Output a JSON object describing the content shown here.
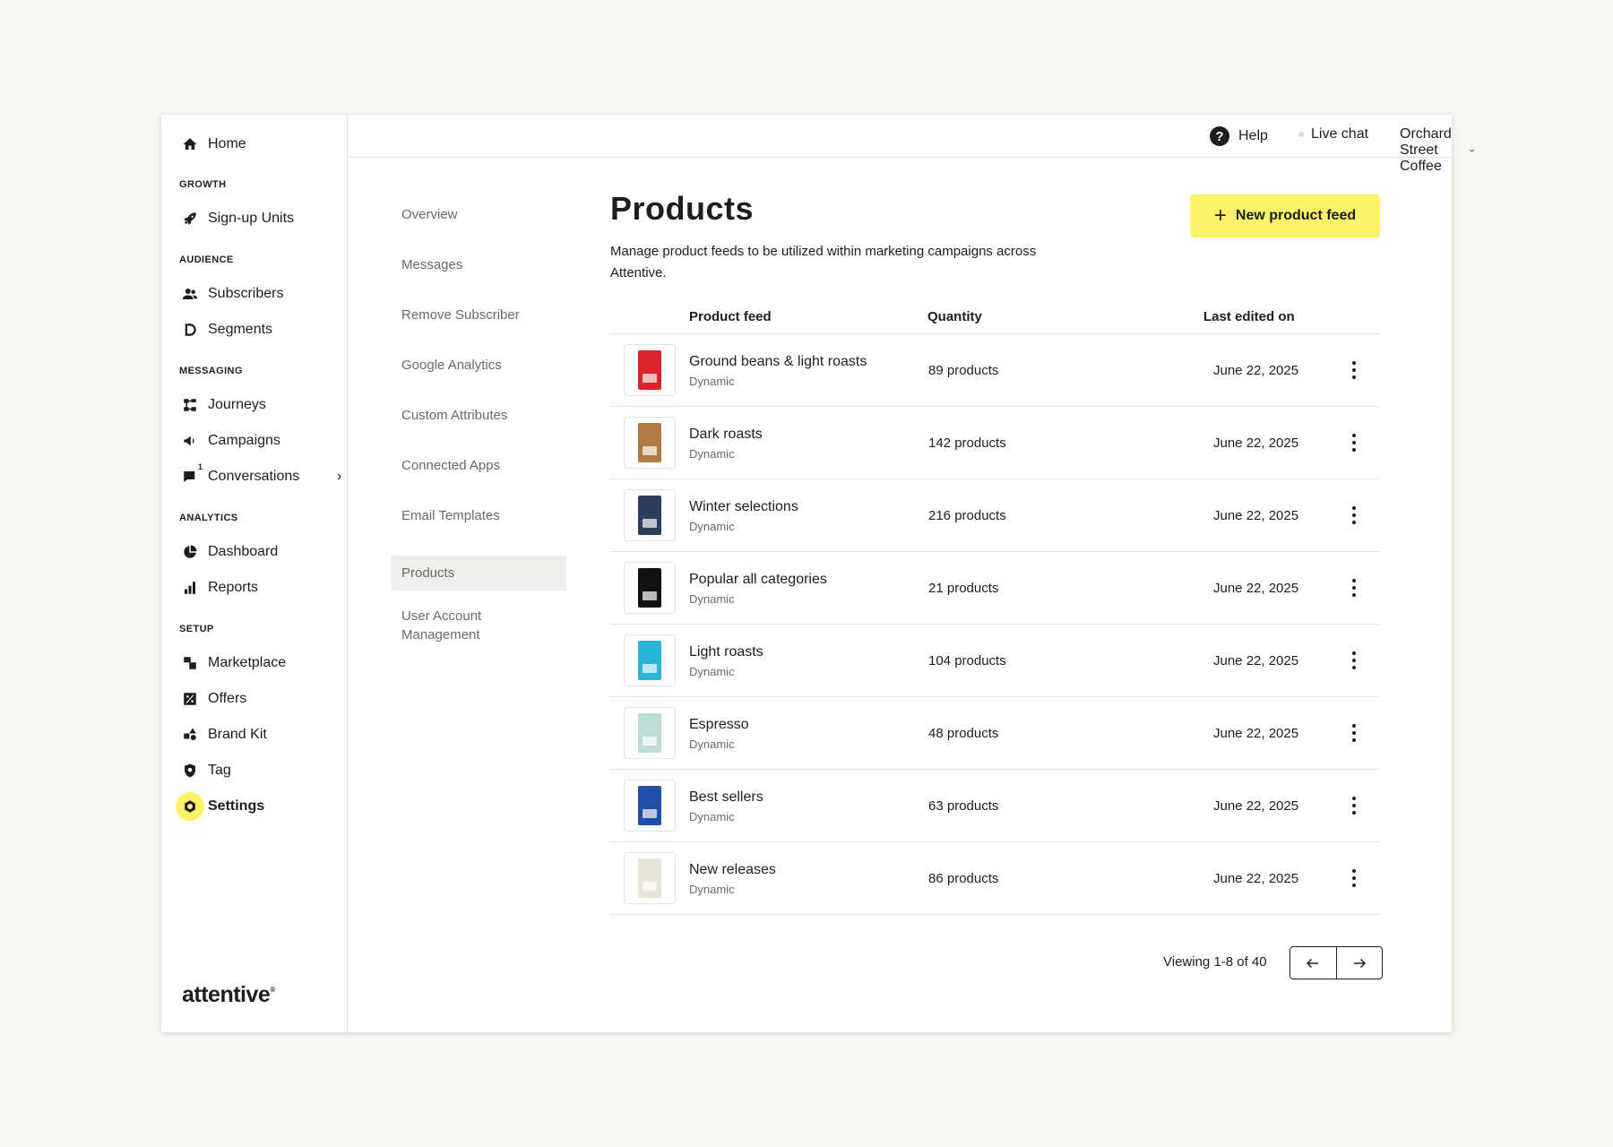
{
  "app": {
    "logo": "attentive",
    "nav": {
      "home": "Home",
      "sections": {
        "growth": "GROWTH",
        "audience": "AUDIENCE",
        "messaging": "MESSAGING",
        "analytics": "ANALYTICS",
        "setup": "SETUP"
      },
      "items": {
        "signup_units": "Sign-up Units",
        "subscribers": "Subscribers",
        "segments": "Segments",
        "journeys": "Journeys",
        "campaigns": "Campaigns",
        "conversations": "Conversations",
        "conversations_badge": "1",
        "dashboard": "Dashboard",
        "reports": "Reports",
        "marketplace": "Marketplace",
        "offers": "Offers",
        "brand_kit": "Brand Kit",
        "tag": "Tag",
        "settings": "Settings"
      }
    },
    "topbar": {
      "help": "Help",
      "live_chat": "Live chat",
      "account": "Orchard Street Coffee"
    }
  },
  "subnav": {
    "overview": "Overview",
    "messages": "Messages",
    "remove_subscriber": "Remove Subscriber",
    "google_analytics": "Google Analytics",
    "custom_attributes": "Custom Attributes",
    "connected_apps": "Connected Apps",
    "email_templates": "Email Templates",
    "products": "Products",
    "user_account_management": "User Account Management"
  },
  "page": {
    "title": "Products",
    "description": "Manage product feeds to be utilized within marketing campaigns across Attentive.",
    "new_button": "New product feed"
  },
  "table": {
    "headers": {
      "product_feed": "Product feed",
      "quantity": "Quantity",
      "last_edited": "Last edited on"
    },
    "rows": [
      {
        "name": "Ground beans & light roasts",
        "type": "Dynamic",
        "quantity": "89 products",
        "date": "June 22, 2025",
        "thumb_color": "#d9252a"
      },
      {
        "name": "Dark roasts",
        "type": "Dynamic",
        "quantity": "142 products",
        "date": "June 22, 2025",
        "thumb_color": "#b07a45"
      },
      {
        "name": "Winter selections",
        "type": "Dynamic",
        "quantity": "216 products",
        "date": "June 22, 2025",
        "thumb_color": "#2c3e5c"
      },
      {
        "name": "Popular all categories",
        "type": "Dynamic",
        "quantity": "21 products",
        "date": "June 22, 2025",
        "thumb_color": "#111111"
      },
      {
        "name": "Light roasts",
        "type": "Dynamic",
        "quantity": "104 products",
        "date": "June 22, 2025",
        "thumb_color": "#29b6d6"
      },
      {
        "name": "Espresso",
        "type": "Dynamic",
        "quantity": "48 products",
        "date": "June 22, 2025",
        "thumb_color": "#bcdcd8"
      },
      {
        "name": "Best sellers",
        "type": "Dynamic",
        "quantity": "63 products",
        "date": "June 22, 2025",
        "thumb_color": "#1f4fa8"
      },
      {
        "name": "New releases",
        "type": "Dynamic",
        "quantity": "86 products",
        "date": "June 22, 2025",
        "thumb_color": "#e8e4da"
      }
    ]
  },
  "pagination": {
    "text": "Viewing 1-8 of 40"
  }
}
